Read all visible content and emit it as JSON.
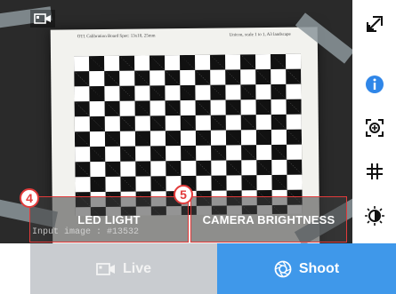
{
  "viewport": {
    "paper_title": "OT1 Calibration Board Spec: 13x10, 25mm",
    "paper_note": "Unicon, scale 1 to 1, A3 landscape",
    "input_info": "Input image : #13532"
  },
  "controls": {
    "led_light": "LED LIGHT",
    "camera_brightness": "CAMERA BRIGHTNESS",
    "marker_4": "4",
    "marker_5": "5"
  },
  "bottom": {
    "live_label": "Live",
    "shoot_label": "Shoot"
  },
  "sidebar": {
    "icons": [
      "expand-icon",
      "info-icon",
      "focus-target-icon",
      "grid-icon",
      "contrast-icon"
    ]
  },
  "colors": {
    "accent_blue": "#3f98ea",
    "disabled_gray": "#c9ccd0",
    "annotation_red": "#e23b3b"
  }
}
